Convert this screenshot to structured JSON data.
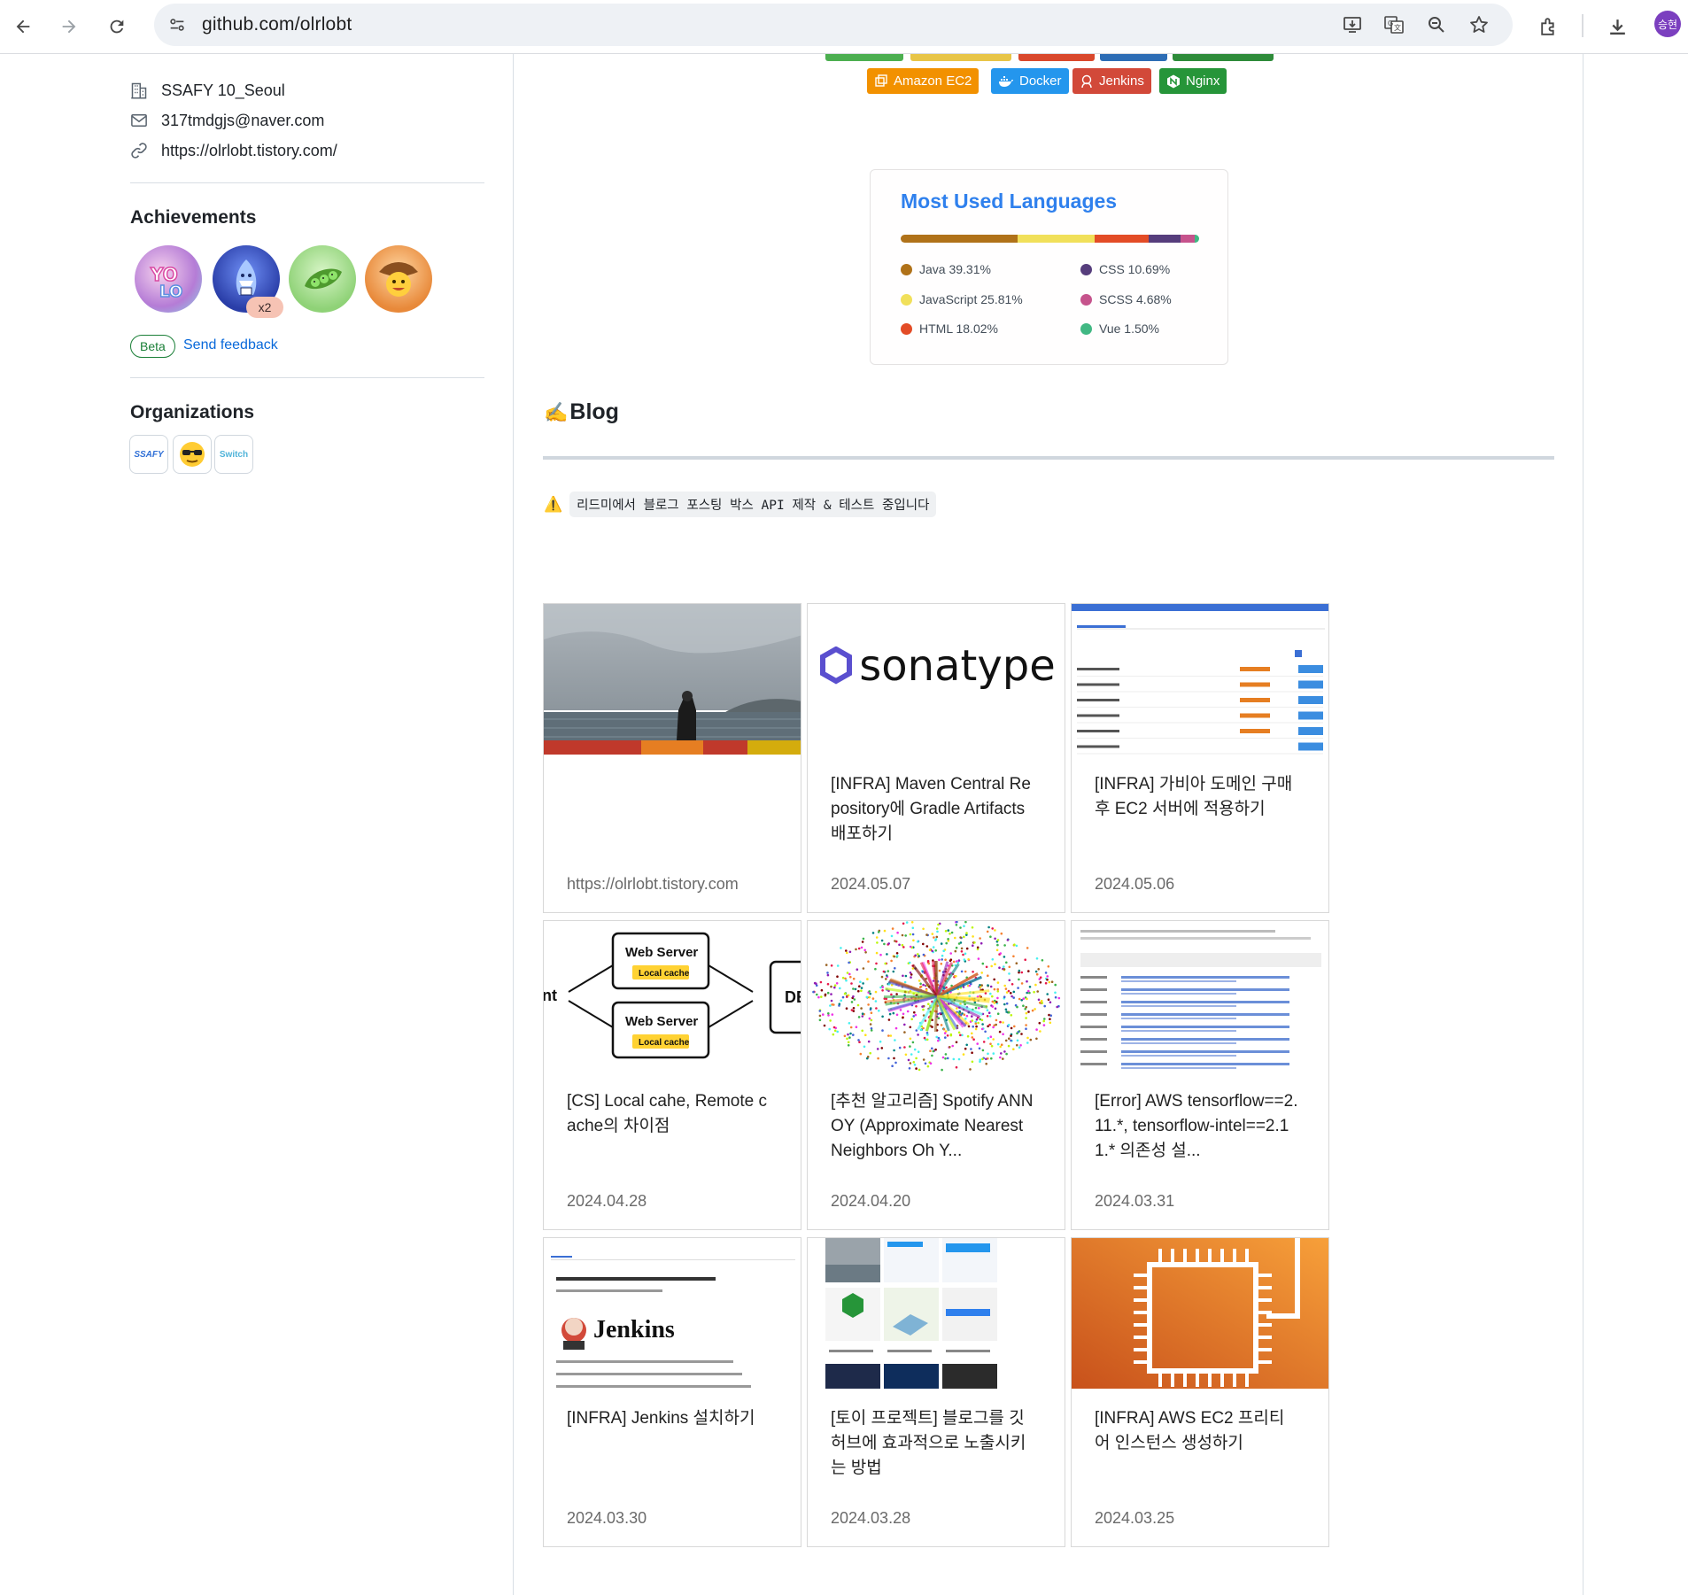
{
  "browser": {
    "url": "github.com/olrlobt",
    "profile_label": "승현"
  },
  "sidebar": {
    "company": "SSAFY 10_Seoul",
    "email": "317tmdgjs@naver.com",
    "website": "https://olrlobt.tistory.com/",
    "achievements_title": "Achievements",
    "achievements": [
      {
        "name": "YOLO",
        "icon": "yolo-badge-icon"
      },
      {
        "name": "Pull Shark",
        "icon": "shark-badge-icon",
        "count": "x2"
      },
      {
        "name": "Pair Extraordinaire",
        "icon": "peas-badge-icon"
      },
      {
        "name": "Quickdraw",
        "icon": "cowboy-badge-icon"
      }
    ],
    "beta_label": "Beta",
    "feedback_label": "Send feedback",
    "organizations_title": "Organizations",
    "organizations": [
      {
        "name": "SSAFY",
        "label": "SSAFY"
      },
      {
        "name": "sunglasses-org",
        "label": ""
      },
      {
        "name": "Switch",
        "label": "Switch"
      }
    ]
  },
  "tech_badges": [
    {
      "label": "Amazon EC2",
      "color": "#f29100"
    },
    {
      "label": "Docker",
      "color": "#2496ed"
    },
    {
      "label": "Jenkins",
      "color": "#d24939"
    },
    {
      "label": "Nginx",
      "color": "#269539"
    }
  ],
  "languages": {
    "title": "Most Used Languages",
    "items": [
      {
        "name": "Java",
        "percent": 39.31,
        "label": "Java 39.31%",
        "color": "#b07219"
      },
      {
        "name": "JavaScript",
        "percent": 25.81,
        "label": "JavaScript 25.81%",
        "color": "#f1e05a"
      },
      {
        "name": "HTML",
        "percent": 18.02,
        "label": "HTML 18.02%",
        "color": "#e34c26"
      },
      {
        "name": "CSS",
        "percent": 10.69,
        "label": "CSS 10.69%",
        "color": "#563d7c"
      },
      {
        "name": "SCSS",
        "percent": 4.68,
        "label": "SCSS 4.68%",
        "color": "#c6538c"
      },
      {
        "name": "Vue",
        "percent": 1.5,
        "label": "Vue 1.50%",
        "color": "#41b883"
      }
    ]
  },
  "blog": {
    "heading_emoji": "✍️",
    "heading": "Blog",
    "notice_icon": "⚠️",
    "notice": "리드미에서 블로그 포스팅 박스 API 제작 & 테스트 중입니다",
    "posts": [
      {
        "title": "",
        "date": "https://olrlobt.tistory.com",
        "thumb": "sea-photo"
      },
      {
        "title": "[INFRA] Maven Central Repository에 Gradle Artifacts 배포하기",
        "date": "2024.05.07",
        "thumb": "sonatype",
        "thumb_text": "sonatype"
      },
      {
        "title": "[INFRA] 가비아 도메인 구매 후 EC2 서버에 적용하기",
        "date": "2024.05.06",
        "thumb": "domain-table"
      },
      {
        "title": "[CS] Local cahe, Remote cache의 차이점",
        "date": "2024.04.28",
        "thumb": "cache-diagram",
        "thumb_labels": [
          "Web Server",
          "Local cache",
          "Web Server",
          "Local cache",
          "nt",
          "DE"
        ]
      },
      {
        "title": "[추천 알고리즘] Spotify ANNOY (Approximate Nearest Neighbors Oh Y...",
        "date": "2024.04.20",
        "thumb": "scatter"
      },
      {
        "title": "[Error] AWS tensorflow==2.11.*, tensorflow-intel==2.11.* 의존성 설...",
        "date": "2024.03.31",
        "thumb": "docs"
      },
      {
        "title": "[INFRA] Jenkins 설치하기",
        "date": "2024.03.30",
        "thumb": "jenkins",
        "thumb_text": "Jenkins"
      },
      {
        "title": "[토이 프로젝트] 블로그를 깃허브에 효과적으로 노출시키는 방법",
        "date": "2024.03.28",
        "thumb": "collage"
      },
      {
        "title": "[INFRA] AWS EC2 프리티어 인스턴스 생성하기",
        "date": "2024.03.25",
        "thumb": "ec2"
      }
    ]
  }
}
